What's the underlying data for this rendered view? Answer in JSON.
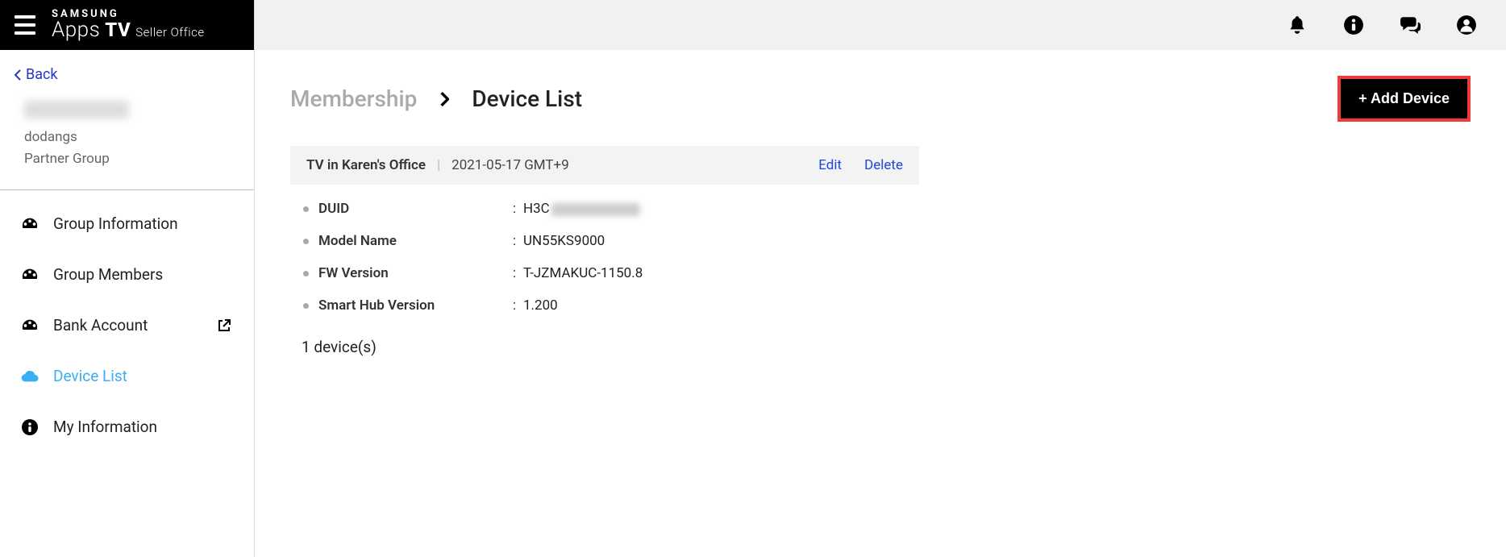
{
  "brand": {
    "top": "SAMSUNG",
    "apps": "Apps",
    "tv": "TV",
    "seller": "Seller Office"
  },
  "back_label": "Back",
  "user": {
    "id": "dodangs",
    "group": "Partner Group"
  },
  "nav": {
    "group_info": "Group Information",
    "group_members": "Group Members",
    "bank_account": "Bank Account",
    "device_list": "Device List",
    "my_information": "My Information"
  },
  "breadcrumb": {
    "section": "Membership",
    "page": "Device List"
  },
  "add_device": "+ Add Device",
  "card": {
    "title": "TV in Karen's Office",
    "date": "2021-05-17 GMT+9",
    "edit": "Edit",
    "delete": "Delete"
  },
  "fields": {
    "duid_label": "DUID",
    "duid_value": "H3C",
    "model_label": "Model Name",
    "model_value": "UN55KS9000",
    "fw_label": "FW Version",
    "fw_value": "T-JZMAKUC-1150.8",
    "hub_label": "Smart Hub Version",
    "hub_value": "1.200"
  },
  "count": "1 device(s)"
}
